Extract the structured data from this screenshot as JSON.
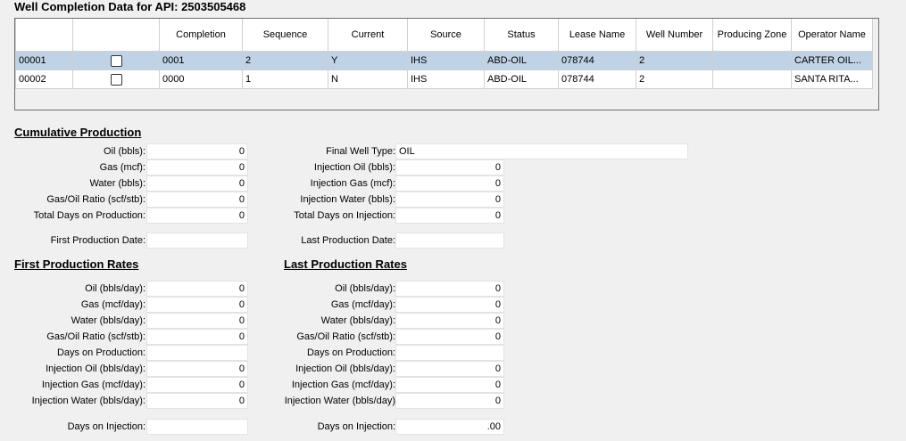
{
  "title": "Well Completion Data for API: 2503505468",
  "grid": {
    "columns": [
      "Completion",
      "Sequence",
      "Current",
      "Source",
      "Status",
      "Lease Name",
      "Well Number",
      "Producing Zone",
      "Operator Name"
    ],
    "rows": [
      {
        "id": "00001",
        "completion": "0001",
        "sequence": "2",
        "current": "Y",
        "source": "IHS",
        "status": "ABD-OIL",
        "lease": "078744",
        "well_number": "2",
        "zone": "",
        "operator": "CARTER OIL..."
      },
      {
        "id": "00002",
        "completion": "0000",
        "sequence": "1",
        "current": "N",
        "source": "IHS",
        "status": "ABD-OIL",
        "lease": "078744",
        "well_number": "2",
        "zone": "",
        "operator": "SANTA RITA..."
      }
    ]
  },
  "cumulative": {
    "heading": "Cumulative Production",
    "left": [
      {
        "label": "Oil (bbls):",
        "value": "0"
      },
      {
        "label": "Gas (mcf):",
        "value": "0"
      },
      {
        "label": "Water (bbls):",
        "value": "0"
      },
      {
        "label": "Gas/Oil Ratio (scf/stb):",
        "value": "0"
      },
      {
        "label": "Total Days on Production:",
        "value": "0"
      },
      {
        "label": "First Production Date:",
        "value": ""
      }
    ],
    "right": [
      {
        "label": "Final Well Type:",
        "value": "OIL"
      },
      {
        "label": "Injection Oil (bbls):",
        "value": "0"
      },
      {
        "label": "Injection Gas (mcf):",
        "value": "0"
      },
      {
        "label": "Injection Water (bbls):",
        "value": "0"
      },
      {
        "label": "Total Days on Injection:",
        "value": "0"
      },
      {
        "label": "Last Production Date:",
        "value": ""
      }
    ]
  },
  "first_rates": {
    "heading": "First Production Rates",
    "items": [
      {
        "label": "Oil (bbls/day):",
        "value": "0"
      },
      {
        "label": "Gas (mcf/day):",
        "value": "0"
      },
      {
        "label": "Water (bbls/day):",
        "value": "0"
      },
      {
        "label": "Gas/Oil Ratio (scf/stb):",
        "value": "0"
      },
      {
        "label": "Days on Production:",
        "value": ""
      },
      {
        "label": "Injection Oil (bbls/day):",
        "value": "0"
      },
      {
        "label": "Injection Gas (mcf/day):",
        "value": "0"
      },
      {
        "label": "Injection Water (bbls/day):",
        "value": "0"
      },
      {
        "label": "Days on Injection:",
        "value": ""
      }
    ]
  },
  "last_rates": {
    "heading": "Last Production Rates",
    "items": [
      {
        "label": "Oil (bbls/day):",
        "value": "0"
      },
      {
        "label": "Gas (mcf/day):",
        "value": "0"
      },
      {
        "label": "Water (bbls/day):",
        "value": "0"
      },
      {
        "label": "Gas/Oil Ratio (scf/stb):",
        "value": "0"
      },
      {
        "label": "Days on Production:",
        "value": ""
      },
      {
        "label": "Injection Oil (bbls/day):",
        "value": "0"
      },
      {
        "label": "Injection Gas (mcf/day):",
        "value": "0"
      },
      {
        "label": "Injection Water (bbls/day)",
        "value": "0"
      },
      {
        "label": "Days on Injection:",
        "value": ".00"
      }
    ]
  },
  "colors": {
    "selected_row": "#c0d2e6",
    "field_bg": "#ffffff",
    "window_bg": "#f0f0f0"
  }
}
